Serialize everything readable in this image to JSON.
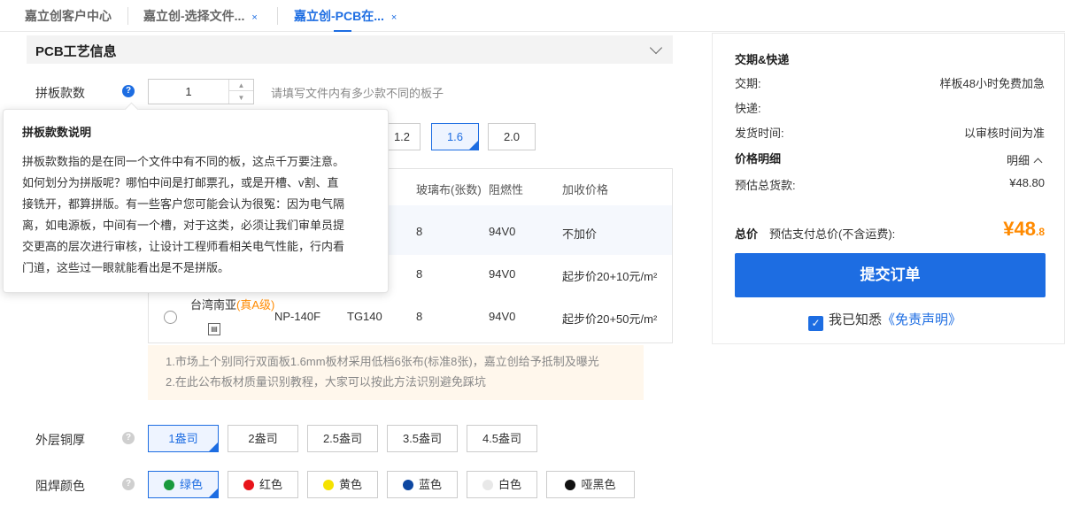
{
  "tabs": [
    {
      "label": "嘉立创客户中心"
    },
    {
      "label": "嘉立创-选择文件...",
      "close": "×"
    },
    {
      "label": "嘉立创-PCB在...",
      "close": "×"
    }
  ],
  "section": {
    "title": "PCB工艺信息"
  },
  "panel_count": {
    "label": "拼板款数",
    "value": "1",
    "hint": "请填写文件内有多少款不同的板子"
  },
  "thickness": {
    "options": [
      "1.2",
      "1.6",
      "2.0"
    ],
    "selected": "1.6"
  },
  "material_table": {
    "headers": [
      "玻璃布(张数)",
      "阻燃性",
      "加收价格"
    ],
    "rows": [
      {
        "glass": "8",
        "fr": "94V0",
        "price": "不加价"
      },
      {
        "glass": "8",
        "fr": "94V0",
        "price": "起步价20+10元/m²"
      },
      {
        "brand": "台湾南亚",
        "grade": "(真A级)",
        "model": "NP-140F",
        "tg": "TG140",
        "glass": "8",
        "fr": "94V0",
        "price": "起步价20+50元/m²"
      }
    ]
  },
  "notes": [
    "1.市场上个别同行双面板1.6mm板材采用低档6张布(标准8张)，嘉立创给予抵制及曝光",
    "2.在此公布板材质量识别教程，大家可以按此方法识别避免踩坑"
  ],
  "copper": {
    "label": "外层铜厚",
    "options": [
      "1盎司",
      "2盎司",
      "2.5盎司",
      "3.5盎司",
      "4.5盎司"
    ],
    "selected": "1盎司"
  },
  "soldermask": {
    "label": "阻焊颜色",
    "options": [
      {
        "label": "绿色",
        "color": "#1a9a3c"
      },
      {
        "label": "红色",
        "color": "#e8141a"
      },
      {
        "label": "黄色",
        "color": "#f5e200"
      },
      {
        "label": "蓝色",
        "color": "#0d47a1"
      },
      {
        "label": "白色",
        "color": "#e8e8e8"
      },
      {
        "label": "哑黑色",
        "color": "#111111"
      }
    ],
    "selected": "绿色"
  },
  "tooltip": {
    "title": "拼板款数说明",
    "lines": [
      "拼板款数指的是在同一个文件中有不同的板，这点千万要注意。",
      "如何划分为拼版呢？哪怕中间是打邮票孔，或是开槽、v割、直",
      "接铣开，都算拼版。有一些客户您可能会认为很冤：因为电气隔",
      "离，如电源板，中间有一个槽，对于这类，必须让我们审单员提",
      "交更高的层次进行审核，让设计工程师看相关电气性能，行内看",
      "门道，这些过一眼就能看出是不是拼版。"
    ]
  },
  "summary": {
    "delivery_title": "交期&快递",
    "lead_time_label": "交期:",
    "lead_time_value": "样板48小时免费加急",
    "courier_label": "快递:",
    "ship_time_label": "发货时间:",
    "ship_time_value": "以审核时间为准",
    "price_detail_title": "价格明细",
    "detail_toggle": "明细",
    "goods_label": "预估总货款:",
    "goods_value": "¥48.80",
    "total_label": "总价",
    "total_desc": "预估支付总价(不含运费):",
    "total_main": "¥48",
    "total_decimal": ".8",
    "submit_label": "提交订单",
    "agree_text": "我已知悉",
    "disclaimer_link": "《免责声明》"
  },
  "colors": {
    "accent": "#1d6de2",
    "price": "#ff8a00"
  }
}
